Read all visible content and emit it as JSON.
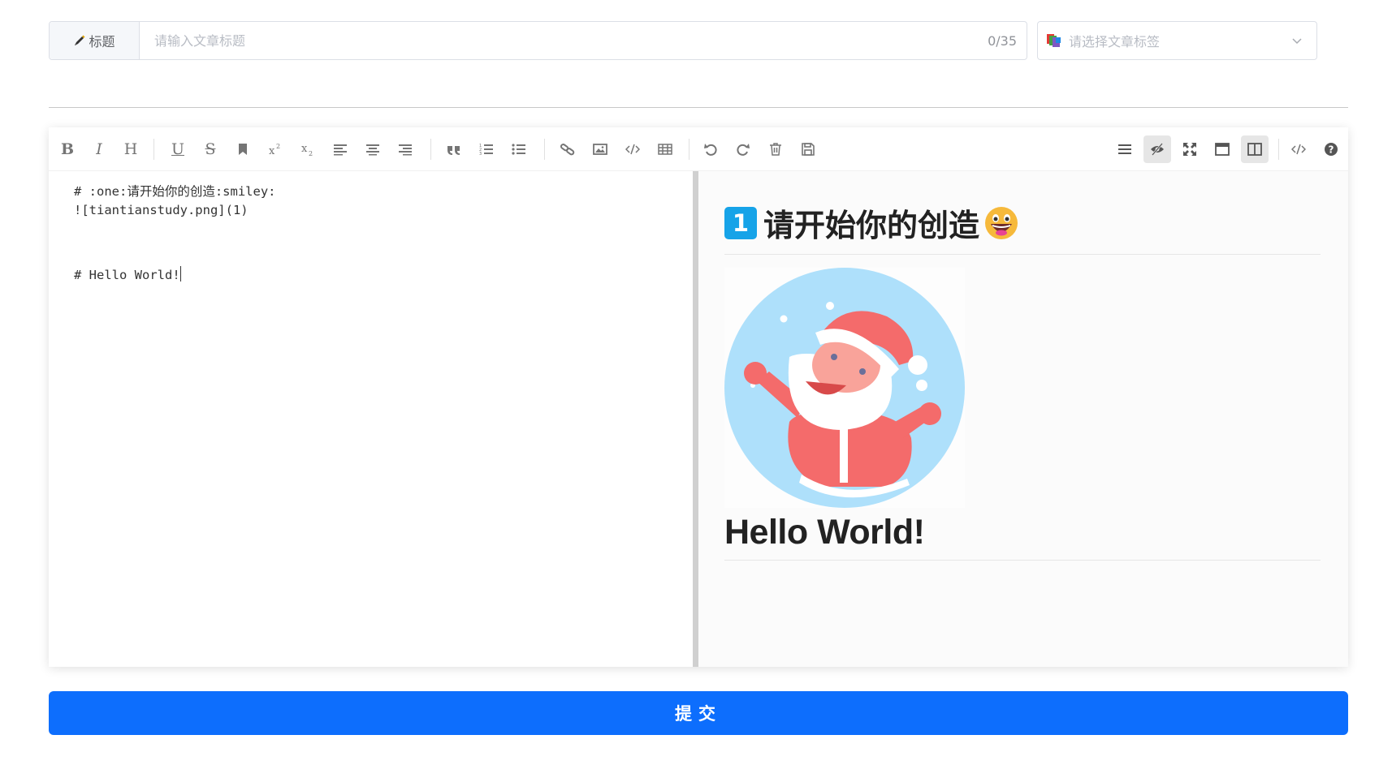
{
  "title_field": {
    "prepend_label": "标题",
    "prepend_icon": "pencil-icon",
    "placeholder": "请输入文章标题",
    "value": "",
    "counter": "0/35"
  },
  "tag_select": {
    "icon": "tags-icon",
    "placeholder": "请选择文章标签"
  },
  "toolbar": {
    "left": [
      "bold",
      "italic",
      "header",
      "underline",
      "strikethrough",
      "mark",
      "superscript",
      "subscript",
      "align-left",
      "align-center",
      "align-right",
      "quote",
      "ordered-list",
      "unordered-list",
      "link",
      "image",
      "code",
      "table",
      "undo",
      "redo",
      "trash",
      "save"
    ],
    "right": [
      "navigation",
      "preview",
      "fullscreen",
      "read-model",
      "subfield",
      "html-code",
      "help"
    ],
    "labels": {
      "bold": "B",
      "italic": "I",
      "header": "H",
      "underline": "U",
      "strikethrough": "S"
    }
  },
  "editor": {
    "lines": [
      "# :one:请开始你的创造:smiley:",
      "![tiantianstudy.png](1)",
      "",
      "",
      "# Hello World!"
    ]
  },
  "preview": {
    "heading1_keycap": "1",
    "heading1": "请开始你的创造",
    "image_alt": "tiantianstudy.png",
    "heading2": "Hello World!"
  },
  "submit_label": "提交",
  "colors": {
    "primary": "#0d6efd",
    "keycap": "#16a3e8"
  }
}
